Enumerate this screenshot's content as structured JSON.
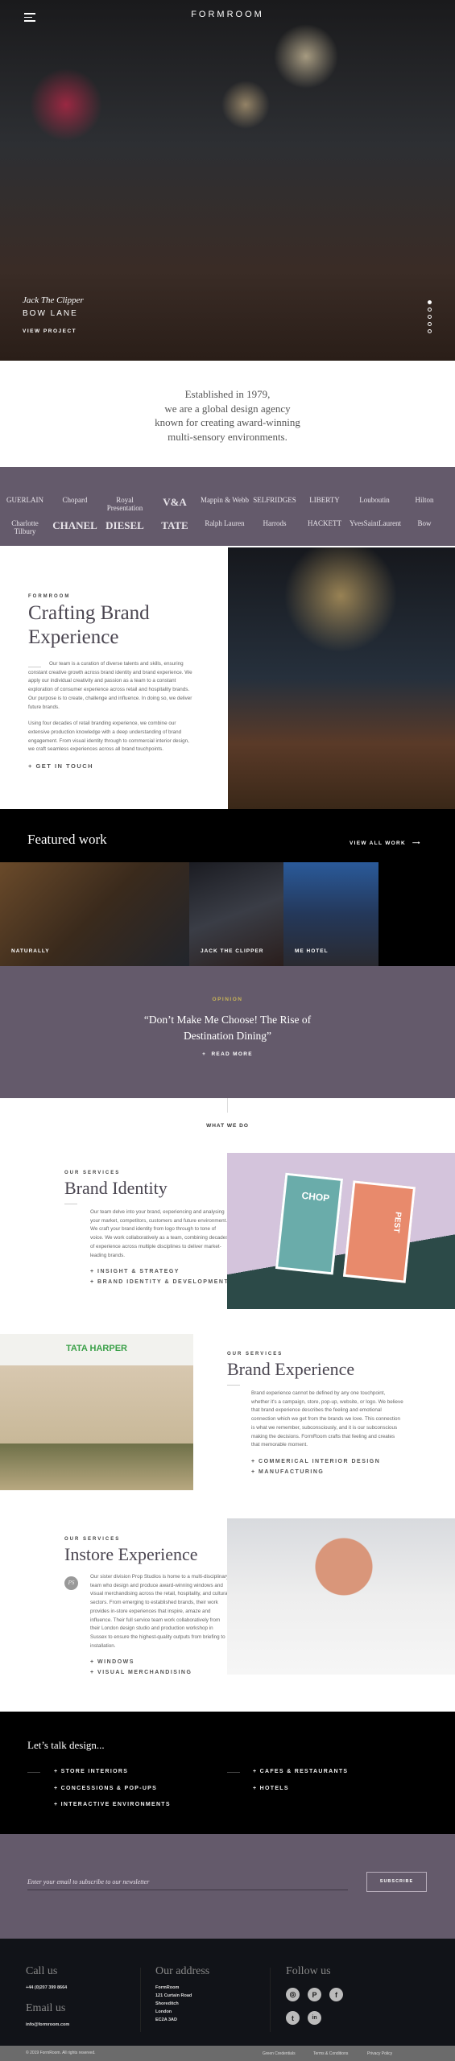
{
  "nav": {
    "logo": "FORMROOM",
    "menu_icon": "hamburger-icon"
  },
  "hero": {
    "client": "Jack The Clipper",
    "location": "BOW LANE",
    "cta": "VIEW PROJECT",
    "slides": 5,
    "active_slide": 1
  },
  "intro": {
    "lines": [
      "Established in 1979,",
      "we are a global design agency",
      "known for creating award-winning",
      "multi-sensory environments."
    ]
  },
  "clients": {
    "row1": [
      "GUERLAIN",
      "Chopard",
      "Royal Presentation",
      "V&A",
      "Mappin & Webb",
      "SELFRIDGES",
      "LIBERTY",
      "Louboutin",
      "Hilton"
    ],
    "row2": [
      "Charlotte Tilbury",
      "CHANEL",
      "DIESEL",
      "TATE",
      "Ralph Lauren",
      "Harrods",
      "HACKETT",
      "YvesSaintLaurent",
      "Bow"
    ]
  },
  "about": {
    "eyebrow": "FORMROOM",
    "title_lines": [
      "Crafting Brand",
      "Experience"
    ],
    "p1": "Our team is a curation of diverse talents and skills, ensuring constant creative growth across brand identity and brand experience. We apply our individual creativity and passion as a team to a constant exploration of consumer experience across retail and hospitality brands. Our purpose is to create, challenge and influence. In doing so, we deliver future brands.",
    "p2": "Using four decades of retail branding experience, we combine our extensive production knowledge with a deep understanding of brand engagement. From visual identity through to commercial interior design, we craft seamless experiences across all brand touchpoints.",
    "cta": "GET IN TOUCH"
  },
  "featured": {
    "title": "Featured work",
    "view_all": "VIEW ALL WORK",
    "items": [
      "NATURALLY",
      "JACK THE CLIPPER",
      "ME HOTEL"
    ]
  },
  "opinion": {
    "eyebrow": "OPINION",
    "quote_l1": "“Don’t Make Me Choose! The Rise of",
    "quote_l2": "Destination Dining”",
    "cta": "READ MORE"
  },
  "what_we_do": "WHAT WE DO",
  "services": [
    {
      "eyebrow": "OUR SERVICES",
      "title": "Brand Identity",
      "text": "Our team delve into your brand, experiencing and analysing your market, competitors, customers and future environment. We craft your brand identity from logo through to tone of voice. We work collaboratively as a team, combining decades of experience across multiple disciplines to deliver market-leading brands.",
      "bullets": [
        "INSIGHT & STRATEGY",
        "BRAND IDENTITY & DEVELOPMENT"
      ],
      "poster1": "CHOP",
      "poster2": "PEST"
    },
    {
      "eyebrow": "OUR SERVICES",
      "title": "Brand Experience",
      "text": "Brand experience cannot be defined by any one touchpoint, whether it's a campaign, store, pop-up, website, or logo. We believe that brand experience describes the feeling and emotional connection which we get from the brands we love. This connection is what we remember, subconsciously, and it is our subconscious making the decisions. FormRoom crafts that feeling and creates that memorable moment.",
      "bullets": [
        "COMMERICAL INTERIOR DESIGN",
        "MANUFACTURING"
      ],
      "sign": "TATA HARPER"
    },
    {
      "eyebrow": "OUR SERVICES",
      "title": "Instore Experience",
      "text": "Our sister division Prop Studios is home to a multi-disciplinary team who design and produce award-winning windows and visual merchandising across the retail, hospitality, and cultural sectors. From emerging to established brands, their work provides in-store experiences that inspire, amaze and influence. Their full service team work collaboratively from their London design studio and production workshop in Sussex to ensure the highest-quality outputs from briefing to installation.",
      "bullets": [
        "WINDOWS",
        "VISUAL MERCHANDISING"
      ],
      "monogram": "PS"
    }
  ],
  "talk": {
    "title": "Let’s talk design...",
    "col1": [
      "STORE INTERIORS",
      "CONCESSIONS & POP-UPS",
      "INTERACTIVE ENVIRONMENTS"
    ],
    "col2": [
      "CAFES & RESTAURANTS",
      "HOTELS"
    ]
  },
  "newsletter": {
    "placeholder": "Enter your email to subscribe to our newsletter",
    "button": "SUBSCRIBE"
  },
  "footer": {
    "call_title": "Call us",
    "phone": "+44 (0)207 399 8664",
    "email_title": "Email us",
    "email": "info@formroom.com",
    "address_title": "Our address",
    "address": [
      "FormRoom",
      "121 Curtain Road",
      "Shoreditch",
      "London",
      "EC2A 3AD"
    ],
    "follow_title": "Follow us",
    "social": [
      "instagram",
      "pinterest",
      "facebook",
      "twitter",
      "linkedin"
    ],
    "copyright": "© 2019 FormRoom. All rights reserved.",
    "links": [
      "Green Credentials",
      "Terms & Conditions",
      "Privacy Policy"
    ]
  },
  "colors": {
    "purple": "#645a6b",
    "dark": "#111318",
    "gold": "#c9b458"
  }
}
